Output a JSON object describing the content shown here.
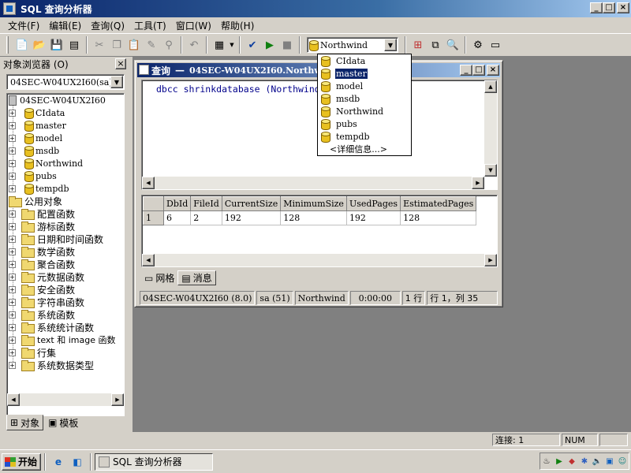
{
  "app": {
    "title": "SQL 查询分析器"
  },
  "menu": [
    {
      "label": "文件(F)"
    },
    {
      "label": "编辑(E)"
    },
    {
      "label": "查询(Q)"
    },
    {
      "label": "工具(T)"
    },
    {
      "label": "窗口(W)"
    },
    {
      "label": "帮助(H)"
    }
  ],
  "toolbar": {
    "database_combo_value": "Northwind",
    "icons": [
      "new-query-icon",
      "open-icon",
      "save-icon",
      "load-script-icon",
      "cut-icon",
      "copy-icon",
      "paste-icon",
      "clear-icon",
      "find-icon",
      "undo-icon",
      "results-mode-icon",
      "parse-icon",
      "execute-icon",
      "stop-icon"
    ]
  },
  "database_dropdown": {
    "items": [
      "CIdata",
      "master",
      "model",
      "msdb",
      "Northwind",
      "pubs",
      "tempdb",
      "<详细信息...>"
    ],
    "highlighted": "master"
  },
  "object_browser": {
    "title": "对象浏览器 (O)",
    "server_combo": "04SEC-W04UX2I60(sa)",
    "server_node": "04SEC-W04UX2I60",
    "databases": [
      "CIdata",
      "master",
      "model",
      "msdb",
      "Northwind",
      "pubs",
      "tempdb"
    ],
    "common_objects": "公用对象",
    "folders": [
      "配置函数",
      "游标函数",
      "日期和时间函数",
      "数学函数",
      "聚合函数",
      "元数据函数",
      "安全函数",
      "字符串函数",
      "系统函数",
      "系统统计函数",
      "text 和 image 函数",
      "行集",
      "系统数据类型"
    ],
    "tabs": [
      "对象",
      "模板"
    ]
  },
  "query_window": {
    "title_label": "查询",
    "title_dash": "—",
    "title_detail": "04SEC-W04UX2I60.Northwi",
    "code": "dbcc shrinkdatabase (Northwind"
  },
  "results": {
    "columns": [
      "DbId",
      "FileId",
      "CurrentSize",
      "MinimumSize",
      "UsedPages",
      "EstimatedPages"
    ],
    "rows": [
      {
        "row_num": "1",
        "cells": [
          "6",
          "2",
          "192",
          "128",
          "192",
          "128"
        ]
      }
    ],
    "tabs": [
      "网格",
      "消息"
    ]
  },
  "query_status": {
    "server": "04SEC-W04UX2I60 (8.0)",
    "user": "sa (51)",
    "database": "Northwind",
    "time": "0:00:00",
    "rows": "1 行",
    "position": "行 1，列 35"
  },
  "statusbar": {
    "connections": "连接: 1",
    "num": "NUM"
  },
  "taskbar": {
    "start": "开始",
    "task": "SQL 查询分析器"
  }
}
